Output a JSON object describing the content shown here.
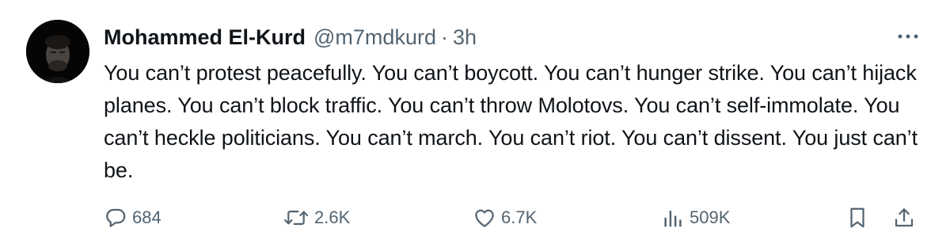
{
  "tweet": {
    "display_name": "Mohammed El-Kurd",
    "handle": "@m7mdkurd",
    "separator": "·",
    "time": "3h",
    "text": "You can’t protest peacefully. You can’t boycott. You can’t hunger strike. You can’t hijack planes. You can’t block traffic. You can’t throw Molotovs. You can’t self-immolate. You can’t heckle politicians. You can’t march. You can’t riot. You can’t dissent. You just can’t be."
  },
  "actions": {
    "replies": "684",
    "retweets": "2.6K",
    "likes": "6.7K",
    "views": "509K"
  },
  "icons": {
    "more": "more-horizontal-icon",
    "reply": "reply-bubble-icon",
    "retweet": "retweet-icon",
    "like": "heart-icon",
    "views": "views-bar-chart-icon",
    "bookmark": "bookmark-icon",
    "share": "share-upload-icon"
  },
  "colors": {
    "text_primary": "#0f1419",
    "text_secondary": "#536471",
    "background": "#ffffff"
  }
}
